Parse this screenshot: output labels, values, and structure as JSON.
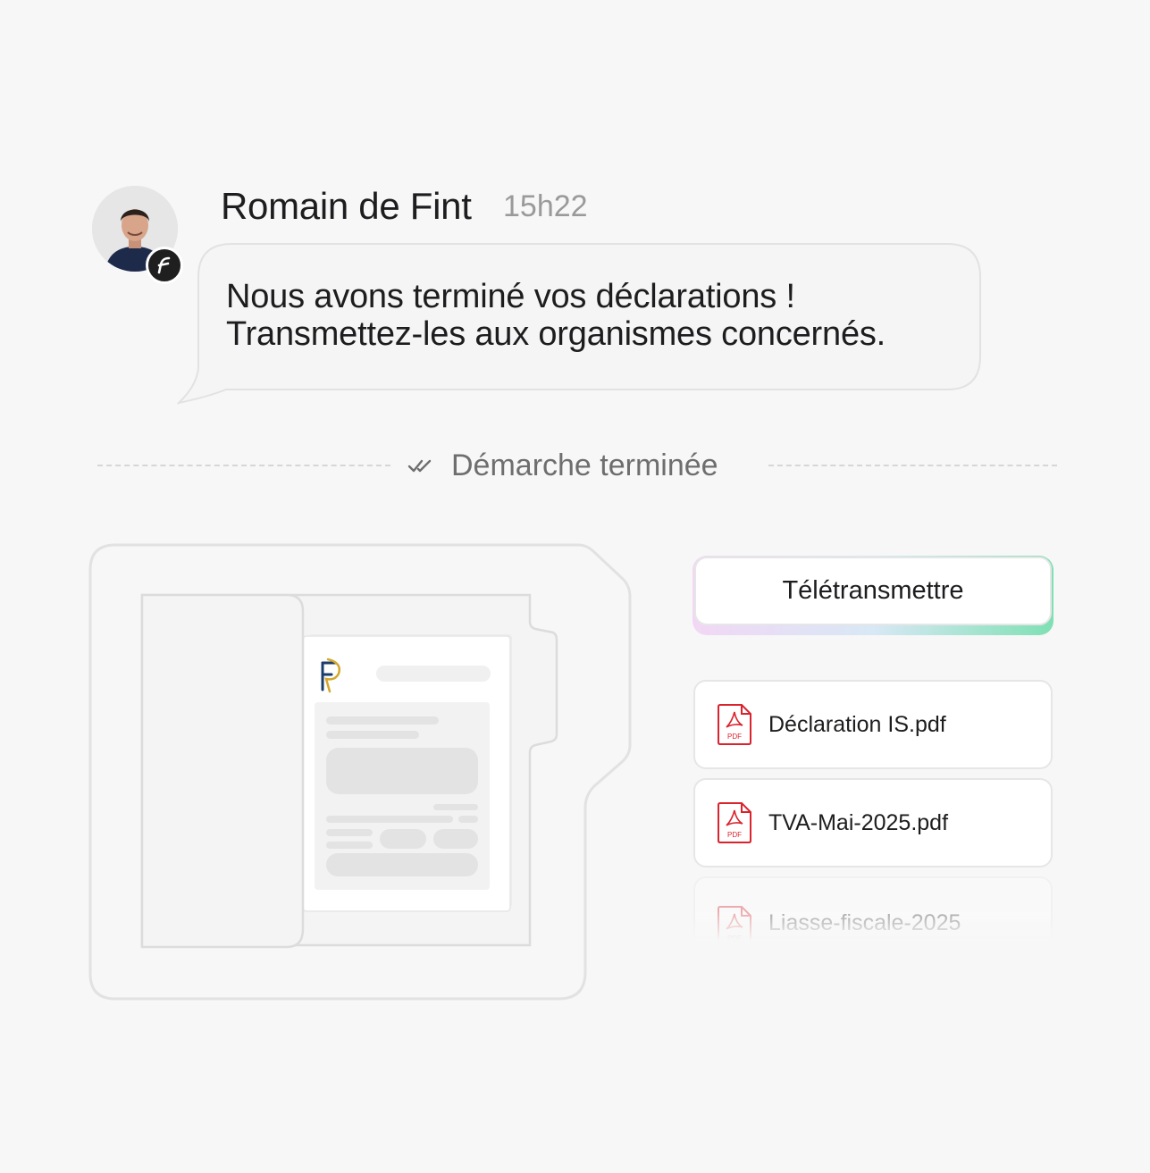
{
  "message": {
    "sender": "Romain de Fint",
    "time": "15h22",
    "line1": "Nous avons terminé vos déclarations !",
    "line2": "Transmettez-les aux organismes concernés."
  },
  "status": {
    "label": "Démarche terminée",
    "icon": "double-check-icon"
  },
  "action": {
    "label": "Télétransmettre"
  },
  "files": [
    {
      "name": "Déclaration IS.pdf",
      "icon": "pdf-icon"
    },
    {
      "name": "TVA-Mai-2025.pdf",
      "icon": "pdf-icon"
    },
    {
      "name": "Liasse-fiscale-2025",
      "icon": "pdf-icon"
    }
  ],
  "colors": {
    "background": "#f7f7f7",
    "text": "#1d1d1f",
    "muted": "#9a9a9a",
    "pdf_red": "#d9232d",
    "gradient_end": "#7fe0b4"
  }
}
